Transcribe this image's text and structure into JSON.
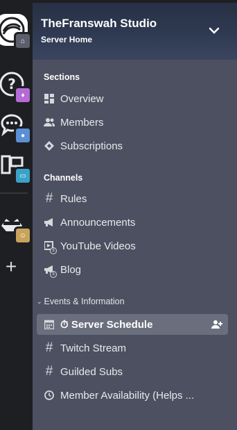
{
  "server": {
    "name": "TheFranswah Studio",
    "subtitle": "Server Home"
  },
  "sidebar": {
    "sections_header": "Sections",
    "sections": [
      {
        "label": "Overview",
        "icon": "grid-icon"
      },
      {
        "label": "Members",
        "icon": "members-icon"
      },
      {
        "label": "Subscriptions",
        "icon": "diamond-icon"
      }
    ],
    "channels_header": "Channels",
    "channels": [
      {
        "label": "Rules",
        "icon": "hash-icon"
      },
      {
        "label": "Announcements",
        "icon": "megaphone-icon"
      },
      {
        "label": "YouTube Videos",
        "icon": "video-icon"
      },
      {
        "label": "Blog",
        "icon": "megaphone-icon"
      }
    ],
    "category": {
      "label": "Events & Information",
      "items": [
        {
          "label": "Server Schedule",
          "icon": "calendar-icon",
          "emoji": "⏱",
          "selected": true
        },
        {
          "label": "Twitch Stream",
          "icon": "hash-icon"
        },
        {
          "label": "Guilded Subs",
          "icon": "hash-icon"
        },
        {
          "label": "Member Availability (Helps ...",
          "icon": "clock-icon"
        }
      ]
    }
  },
  "rail": {
    "servers": [
      "franswah-server",
      "help-server",
      "chat-server",
      "pc-server",
      "dominion-server"
    ],
    "add_label": "+"
  },
  "colors": {
    "rail_bg": "#1e1f22",
    "panel_bg": "#4d5060",
    "selected_bg": "#6b6e7c",
    "text": "#e8eaed"
  }
}
